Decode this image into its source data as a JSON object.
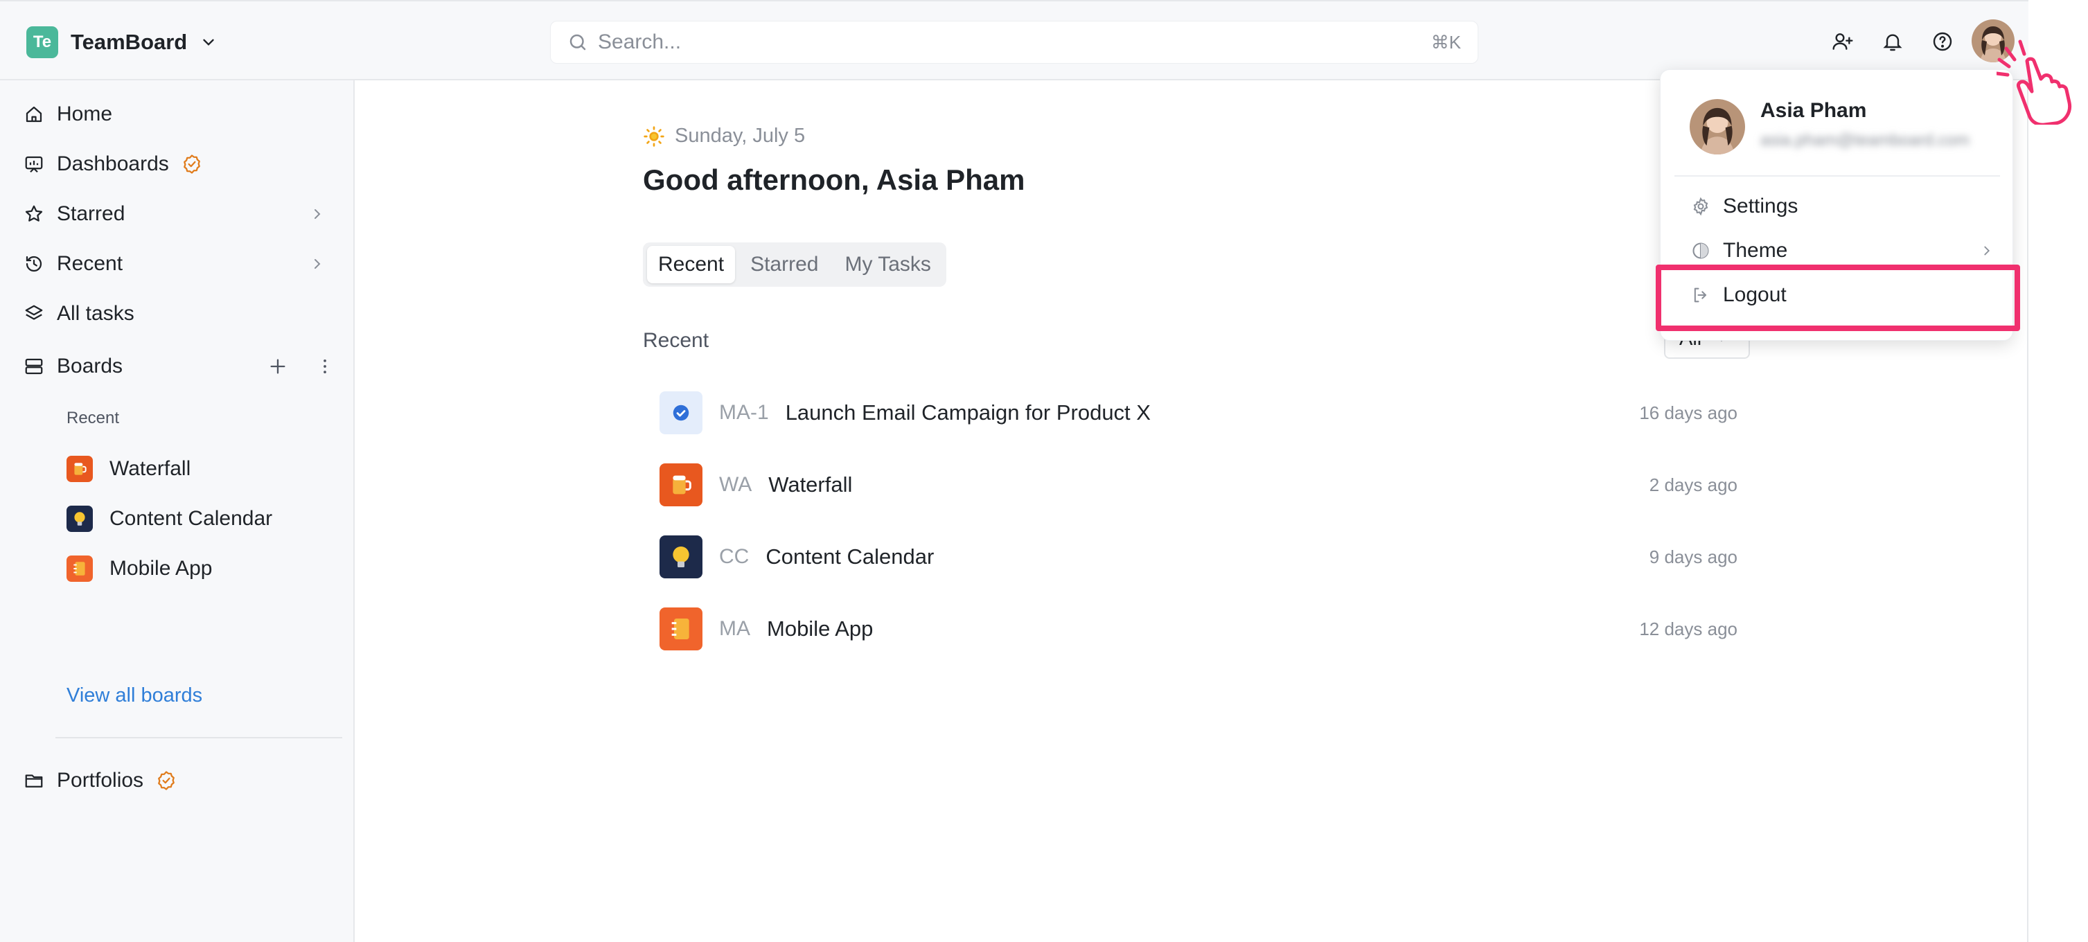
{
  "header": {
    "workspace_badge": "Te",
    "workspace_name": "TeamBoard",
    "search_placeholder": "Search...",
    "search_shortcut": "⌘K",
    "icons": [
      "add-user-icon",
      "bell-icon",
      "help-icon",
      "user-avatar"
    ]
  },
  "sidebar": {
    "items": [
      {
        "label": "Home",
        "icon": "home-icon"
      },
      {
        "label": "Dashboards",
        "icon": "dashboard-icon",
        "badge": "verified-badge-icon"
      },
      {
        "label": "Starred",
        "icon": "star-icon"
      },
      {
        "label": "Recent",
        "icon": "history-icon"
      },
      {
        "label": "All tasks",
        "icon": "layers-icon"
      },
      {
        "label": "Boards",
        "icon": "boards-icon"
      }
    ],
    "recent_label": "Recent",
    "boards": [
      {
        "label": "Waterfall",
        "icon": "beer-mug-icon",
        "color": "#e8581f"
      },
      {
        "label": "Content Calendar",
        "icon": "light-bulb-icon",
        "color": "#1d2a4a"
      },
      {
        "label": "Mobile App",
        "icon": "notebook-icon",
        "color": "#f0642c"
      }
    ],
    "view_all": "View all boards",
    "portfolios": "Portfolios"
  },
  "main": {
    "date": "Sunday, July 5",
    "greeting": "Good afternoon, Asia Pham",
    "tabs": [
      "Recent",
      "Starred",
      "My Tasks"
    ],
    "active_tab": "Recent",
    "section_label": "Recent",
    "filter_value": "All",
    "rows": [
      {
        "key": "MA-1",
        "title": "Launch Email Campaign for Product X",
        "time": "16 days ago",
        "icon": "task-check-icon"
      },
      {
        "key": "WA",
        "title": "Waterfall",
        "time": "2 days ago",
        "icon": "beer-mug-icon"
      },
      {
        "key": "CC",
        "title": "Content Calendar",
        "time": "9 days ago",
        "icon": "light-bulb-icon"
      },
      {
        "key": "MA",
        "title": "Mobile App",
        "time": "12 days ago",
        "icon": "notebook-icon"
      }
    ]
  },
  "user_menu": {
    "name": "Asia Pham",
    "email": "asia.pham@teamboard.com",
    "items": [
      {
        "label": "Settings",
        "icon": "gear-icon"
      },
      {
        "label": "Theme",
        "icon": "theme-icon"
      },
      {
        "label": "Logout",
        "icon": "logout-icon"
      }
    ]
  },
  "colors": {
    "accent_link": "#2f7ed8",
    "highlight": "#f0306e",
    "verified": "#e07b1a"
  }
}
